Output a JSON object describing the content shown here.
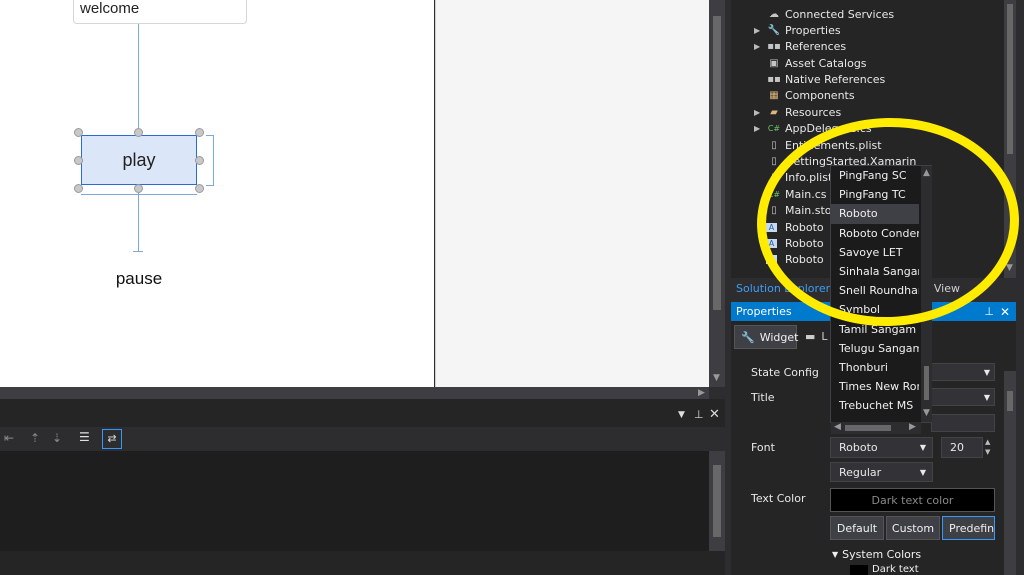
{
  "canvas": {
    "welcome_label": "welcome",
    "play_label": "play",
    "pause_label": "pause"
  },
  "solution_explorer": {
    "items": [
      {
        "label": "Connected Services",
        "icon": "cloud-icon",
        "expandable": false
      },
      {
        "label": "Properties",
        "icon": "wrench-icon",
        "expandable": true
      },
      {
        "label": "References",
        "icon": "references-icon",
        "expandable": true
      },
      {
        "label": "Asset Catalogs",
        "icon": "catalog-icon",
        "expandable": false
      },
      {
        "label": "Native References",
        "icon": "references-icon",
        "expandable": false
      },
      {
        "label": "Components",
        "icon": "package-icon",
        "expandable": false
      },
      {
        "label": "Resources",
        "icon": "folder-icon",
        "expandable": true
      },
      {
        "label": "AppDelegate.cs",
        "icon": "csharp-icon",
        "expandable": true
      },
      {
        "label": "Entitlements.plist",
        "icon": "file-icon",
        "expandable": false
      },
      {
        "label": "GettingStarted.Xamarin",
        "icon": "file-icon",
        "expandable": false
      },
      {
        "label": "Info.plist",
        "icon": "file-icon",
        "expandable": false
      },
      {
        "label": "Main.cs",
        "icon": "csharp-icon",
        "expandable": false
      },
      {
        "label": "Main.storyboard",
        "icon": "file-icon",
        "expandable": false
      },
      {
        "label": "Roboto",
        "icon": "font-file-icon",
        "expandable": false
      },
      {
        "label": "Roboto",
        "icon": "font-file-icon",
        "expandable": false
      },
      {
        "label": "Roboto",
        "icon": "font-file-icon",
        "expandable": false
      }
    ],
    "tabs": {
      "solution_explorer": "Solution Explorer",
      "view": "View"
    }
  },
  "properties": {
    "title": "Properties",
    "widget_tab": "Widget",
    "layout_tab": "L",
    "state_config_label": "State Config",
    "title_label": "Title",
    "font_label": "Font",
    "font_value": "Roboto",
    "font_size": "20",
    "font_style": "Regular",
    "text_color_label": "Text Color",
    "text_color_value": "Dark text color",
    "color_modes": [
      "Default",
      "Custom",
      "Predefined"
    ],
    "system_colors_label": "System Colors",
    "dark_text": "Dark text"
  },
  "font_dropdown": {
    "options": [
      "PingFang SC",
      "PingFang TC",
      "Roboto",
      "Roboto Condensed",
      "Savoye LET",
      "Sinhala Sangam MN",
      "Snell Roundhand",
      "Symbol",
      "Tamil Sangam MN",
      "Telugu Sangam MN",
      "Thonburi",
      "Times New Roman",
      "Trebuchet MS"
    ],
    "selected": "Roboto"
  },
  "colors": {
    "accent": "#007acc",
    "highlight": "#ffec00",
    "selection": "#2a6ad6"
  }
}
